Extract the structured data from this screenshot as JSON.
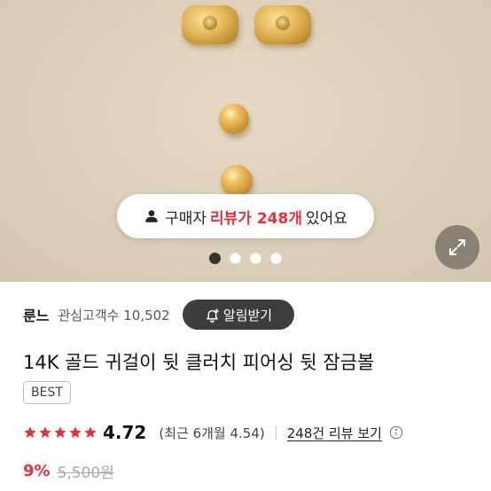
{
  "hero": {
    "review_prefix": "구매자",
    "review_highlight": "리뷰가 248개",
    "review_suffix": "있어요",
    "dots_total": 4,
    "dots_active": 1
  },
  "seller": {
    "name": "룬느",
    "followers_label": "관심고객수 10,502",
    "follow_button": "알림받기"
  },
  "product": {
    "title": "14K 골드 귀걸이 뒷 클러치 피어싱 뒷 잠금볼",
    "badge": "BEST"
  },
  "rating": {
    "value": "4.72",
    "stars": 5,
    "recent": "(최근 6개월 4.54)",
    "review_link": "248건 리뷰 보기"
  },
  "price": {
    "discount": "9%",
    "original": "5,500원"
  },
  "colors": {
    "accent": "#e2323a",
    "dark_button": "#3d3d3d",
    "star": "#e2323a"
  },
  "icons": [
    "person-icon",
    "expand-icon",
    "bell-plus-icon",
    "star-icon",
    "info-icon"
  ]
}
